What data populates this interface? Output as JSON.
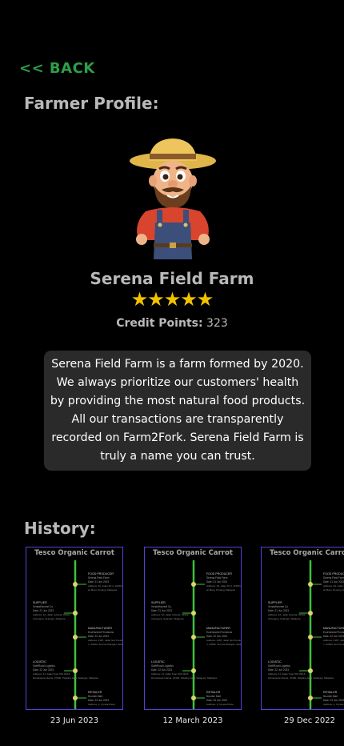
{
  "nav": {
    "back_label": "<< BACK"
  },
  "profile": {
    "section_title": "Farmer Profile:",
    "farm_name": "Serena Field Farm",
    "rating": 5,
    "stars": "★★★★★",
    "credit_label": "Credit Points:",
    "credit_value": "323",
    "description": "Serena Field Farm is a farm formed by 2020. We always prioritize our customers' health by providing the most natural food products. All our transactions are transparently recorded on Farm2Fork. Serena Field Farm is truly a name you can trust."
  },
  "history": {
    "section_title": "History:",
    "cards": [
      {
        "title": "Tesco Organic Carrot",
        "date": "23 Jun 2023"
      },
      {
        "title": "Tesco Organic Carrot",
        "date": "12  March 2023"
      },
      {
        "title": "Tesco Organic Carrot",
        "date": "29 Dec 2022"
      }
    ],
    "stages": {
      "food_producer": {
        "title": "FOOD PRODUCER",
        "name": "Serena Field Farm",
        "date": "Date: 21 Jun 2023",
        "address": "Address: 30, Jalan Pd 4, 11900 Bayan Baru, Penang, Malaysia"
      },
      "supplier": {
        "title": "SUPPLIER",
        "name": "VendaHarvest Co.",
        "date": "Date: 21 Jun 2023",
        "address": "Address: 3A, Jalan Cyberia, 63000 Cyberjaya, Selangor, Malaysia"
      },
      "manufacturer": {
        "title": "MANUFACTURER",
        "name": "EcoHarvest Provisions",
        "date": "Date: 22 Jun 2023",
        "address": "Address: 2187, Jalan Seri Kembangan, 43300, Seri Kembangan, Selangor, Malaysia"
      },
      "logistic": {
        "title": "LOGISTIC",
        "name": "SwiftRoad Logistics",
        "date": "Date: 22 Jun 2023",
        "address": "Address: 41, Jalan Tuan 5x5,33/16 Damansara Utama, 47400, Petaling Jaya, Selangor, Malaysia"
      },
      "retailer": {
        "title": "RETAILER",
        "name": "Nourish Mart",
        "date": "Date: 23 Jun 2023",
        "address": "Address: 1, Crystal Plaza"
      }
    }
  },
  "colors": {
    "back": "#2e9e4a",
    "heading": "#b9b9b9",
    "star": "#f2c200",
    "card_border": "#5a3fd6",
    "timeline": "#3fbf3f",
    "node": "#d9d56a"
  }
}
